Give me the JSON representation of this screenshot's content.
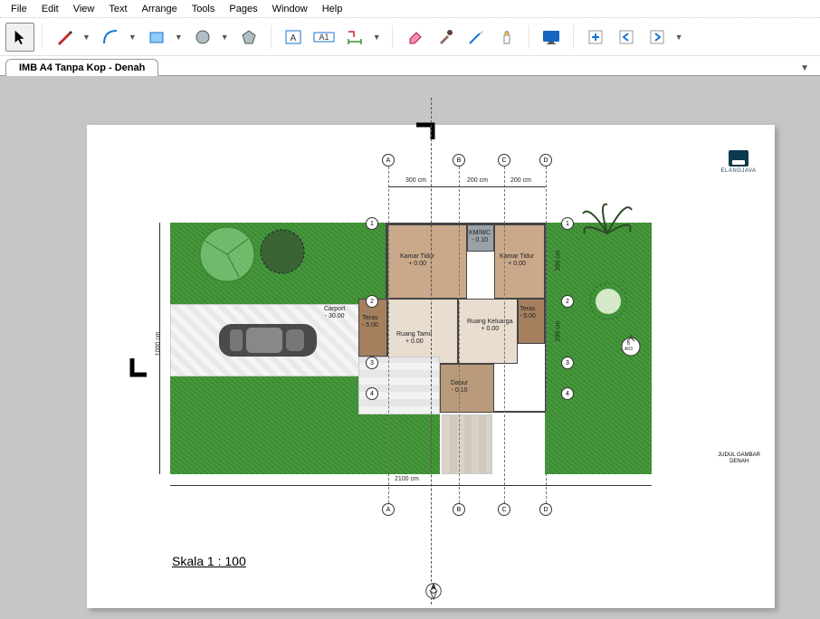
{
  "menu": {
    "items": [
      "File",
      "Edit",
      "View",
      "Text",
      "Arrange",
      "Tools",
      "Pages",
      "Window",
      "Help"
    ]
  },
  "toolbar": {
    "groups": [
      [
        {
          "name": "cursor-icon",
          "sel": true
        }
      ],
      [
        {
          "name": "pencil-icon",
          "drop": true
        },
        {
          "name": "arc-icon",
          "drop": true
        },
        {
          "name": "rectangle-icon",
          "drop": true
        },
        {
          "name": "circle-icon",
          "drop": true
        },
        {
          "name": "polygon-icon",
          "drop": true
        }
      ],
      [
        {
          "name": "text-icon"
        },
        {
          "name": "text-along-icon"
        },
        {
          "name": "measure-icon",
          "drop": true
        }
      ],
      [
        {
          "name": "eraser-icon"
        },
        {
          "name": "eyedropper-icon"
        },
        {
          "name": "knife-icon"
        },
        {
          "name": "glue-icon"
        }
      ],
      [
        {
          "name": "monitor-icon"
        }
      ],
      [
        {
          "name": "page-add-icon"
        },
        {
          "name": "page-prev-icon"
        },
        {
          "name": "page-next-icon",
          "drop": true
        }
      ]
    ]
  },
  "tab": {
    "title": "IMB A4 Tanpa Kop - Denah"
  },
  "plan": {
    "scale_label": "Skala 1 : 100",
    "logo_text": "ELANGJAVA",
    "title_block_l1": "JUDUL GAMBAR",
    "title_block_l2": "DENAH",
    "grid_letters": [
      "A",
      "B",
      "C",
      "D"
    ],
    "grid_numbers": [
      "1",
      "2",
      "3",
      "4"
    ],
    "dims_top": [
      "300 cm",
      "200 cm",
      "200 cm"
    ],
    "dim_left": "1000 cm",
    "dim_bottom": "2100 cm",
    "dim_right_1": "300 cm",
    "dim_right_2": "200 cm",
    "rooms": {
      "carport": {
        "name": "Carport",
        "elev": "- 30.00"
      },
      "teras1": {
        "name": "Teras",
        "elev": "- 5.00"
      },
      "kamar1": {
        "name": "Kamar Tidur",
        "elev": "+ 0.00"
      },
      "kmwc": {
        "name": "KM/WC",
        "elev": "- 0.10"
      },
      "kamar2": {
        "name": "Kamar Tidur",
        "elev": "+ 0.00"
      },
      "rtamu": {
        "name": "Ruang Tamu",
        "elev": "+ 0.00"
      },
      "rkel": {
        "name": "Ruang Keluarga",
        "elev": "+ 0.00"
      },
      "teras2": {
        "name": "Teras",
        "elev": "- 5.00"
      },
      "dapur": {
        "name": "Dapur",
        "elev": "- 0.10"
      }
    },
    "section_marker": "A03"
  }
}
